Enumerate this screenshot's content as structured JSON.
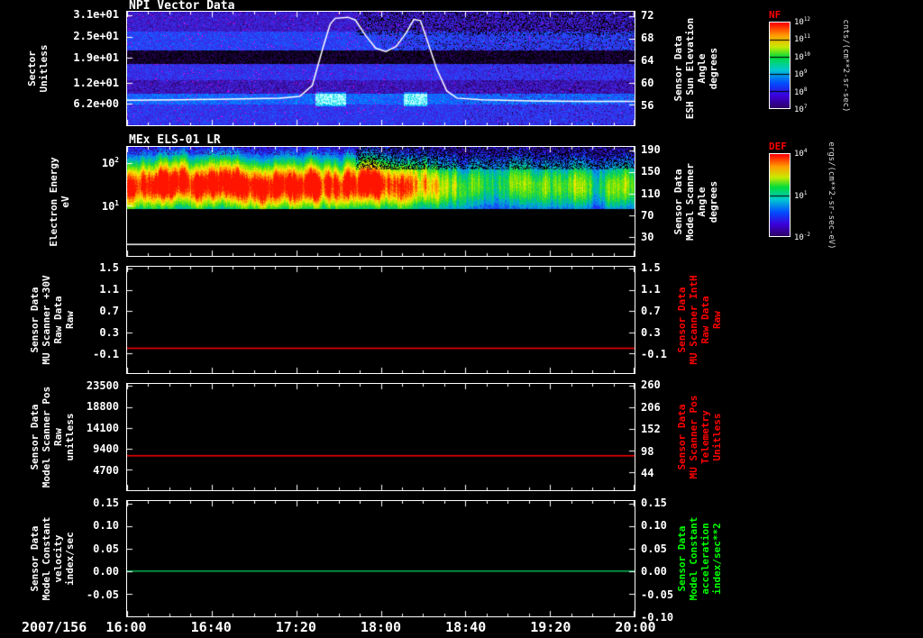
{
  "figure": {
    "bg": "#000000",
    "text_color": "#ffffff",
    "accent_red": "#ff0000",
    "accent_green": "#00ff00"
  },
  "chart_data": {
    "type": "heatmap",
    "description": "Five stacked time-series panels (NPI sector spectrogram with sun elevation line, ELS electron energy spectrogram, and three constant-value housekeeping traces) for day 2007/156, 16:00-20:00 UT",
    "time_axis": {
      "date": "2007/156",
      "start": "16:00",
      "end": "20:00",
      "ticks": [
        "16:00",
        "16:40",
        "17:20",
        "18:00",
        "18:40",
        "19:20",
        "20:00"
      ]
    },
    "panels": [
      {
        "title": "NPI Vector Data",
        "kind": "spectrogram+line",
        "left_label_lines": [
          "Sector",
          "Unitless"
        ],
        "left_range": [
          32,
          0
        ],
        "left_ticks": [
          {
            "label": "3.1e+01",
            "value": 31
          },
          {
            "label": "2.5e+01",
            "value": 25
          },
          {
            "label": "1.9e+01",
            "value": 19
          },
          {
            "label": "1.2e+01",
            "value": 12
          },
          {
            "label": "6.2e+00",
            "value": 6.2
          }
        ],
        "right_label_lines": [
          "Sensor Data",
          "ESH Sun Elevation",
          "Angle",
          "degrees"
        ],
        "right_label_color": "#ffffff",
        "right_range": [
          72.8,
          52.3
        ],
        "right_ticks": [
          {
            "label": "72",
            "value": 72
          },
          {
            "label": "68",
            "value": 68
          },
          {
            "label": "64",
            "value": 64
          },
          {
            "label": "60",
            "value": 60
          },
          {
            "label": "56",
            "value": 56
          }
        ],
        "line": {
          "name": "ESH Sun Elevation Angle",
          "color": "#ffffff",
          "axis": "right",
          "points": [
            [
              0,
              56.8
            ],
            [
              0.1,
              56.9
            ],
            [
              0.2,
              57
            ],
            [
              0.3,
              57.2
            ],
            [
              0.34,
              57.5
            ],
            [
              0.365,
              59.5
            ],
            [
              0.385,
              66
            ],
            [
              0.4,
              70.5
            ],
            [
              0.41,
              71.6
            ],
            [
              0.435,
              71.8
            ],
            [
              0.45,
              71.3
            ],
            [
              0.47,
              68.5
            ],
            [
              0.49,
              66.2
            ],
            [
              0.51,
              65.6
            ],
            [
              0.53,
              66.5
            ],
            [
              0.55,
              69
            ],
            [
              0.565,
              71.4
            ],
            [
              0.578,
              71.2
            ],
            [
              0.59,
              68
            ],
            [
              0.61,
              62.5
            ],
            [
              0.63,
              58.5
            ],
            [
              0.65,
              57.2
            ],
            [
              0.7,
              56.9
            ],
            [
              0.8,
              56.7
            ],
            [
              0.9,
              56.6
            ],
            [
              1,
              56.6
            ]
          ]
        },
        "spectrogram": {
          "summary": "blue/violet sector count map; near-black band around sectors 14-18, bright blue row near sectors 7-9 with cyan patches near 17:30 and 18:10, magenta speckles before 18:40, black dropouts upper right"
        }
      },
      {
        "title": "MEx ELS-01 LR",
        "kind": "spectrogram+line",
        "left_label_lines": [
          "Electron Energy",
          "eV"
        ],
        "left_scale": "log10_eV",
        "left_range": [
          2.375,
          -0.19
        ],
        "left_ticks": [
          {
            "label": "10^2",
            "value": 2
          },
          {
            "label": "10^1",
            "value": 1
          }
        ],
        "right_label_lines": [
          "Sensor Data",
          "Model Scanner",
          "Angle",
          "degrees"
        ],
        "right_label_color": "#ffffff",
        "right_range": [
          196.6,
          -5.9
        ],
        "right_ticks": [
          {
            "label": "190",
            "value": 190
          },
          {
            "label": "150",
            "value": 150
          },
          {
            "label": "110",
            "value": 110
          },
          {
            "label": "70",
            "value": 70
          },
          {
            "label": "30",
            "value": 30
          }
        ],
        "line": {
          "name": "Model Scanner Angle",
          "color": "#ffffff",
          "axis": "right",
          "points": [
            [
              0,
              15.5
            ],
            [
              1,
              15.5
            ]
          ]
        },
        "spectrogram": {
          "summary": "electron differential energy flux ~8-240 eV; intense red/yellow band 20-80 eV until ~18:10, weakening to green/blue afterwards, black dropout speckles at high energy on right half",
          "energy_cut_log": 0.92
        }
      },
      {
        "title": "",
        "kind": "line",
        "left_label_lines": [
          "Sensor Data",
          "MU Scanner +30V",
          "Raw Data",
          "Raw"
        ],
        "left_range": [
          1.54,
          -0.47
        ],
        "left_ticks": [
          {
            "label": "1.5",
            "value": 1.5
          },
          {
            "label": "1.1",
            "value": 1.1
          },
          {
            "label": "0.7",
            "value": 0.7
          },
          {
            "label": "0.3",
            "value": 0.3
          },
          {
            "label": "-0.1",
            "value": -0.1
          }
        ],
        "right_label_lines": [
          "Sensor Data",
          "MU Scanner IntH",
          "Raw Data",
          "Raw"
        ],
        "right_label_color": "#ff0000",
        "right_range": [
          1.54,
          -0.47
        ],
        "right_ticks": [
          {
            "label": "1.5",
            "value": 1.5
          },
          {
            "label": "1.1",
            "value": 1.1
          },
          {
            "label": "0.7",
            "value": 0.7
          },
          {
            "label": "0.3",
            "value": 0.3
          },
          {
            "label": "-0.1",
            "value": -0.1
          }
        ],
        "line": {
          "name": "MU Scanner +30V Raw",
          "color": "#ff0000",
          "axis": "left",
          "points": [
            [
              0,
              0
            ],
            [
              1,
              0
            ]
          ]
        }
      },
      {
        "title": "",
        "kind": "line",
        "left_label_lines": [
          "Sensor Data",
          "Model Scanner Pos",
          "Raw",
          "unitless"
        ],
        "left_range": [
          24000,
          0
        ],
        "left_ticks": [
          {
            "label": "23500",
            "value": 23500
          },
          {
            "label": "18800",
            "value": 18800
          },
          {
            "label": "14100",
            "value": 14100
          },
          {
            "label": "9400",
            "value": 9400
          },
          {
            "label": "4700",
            "value": 4700
          }
        ],
        "right_label_lines": [
          "Sensor Data",
          "MU Scanner Pos",
          "Telemetry",
          "Unitless"
        ],
        "right_label_color": "#ff0000",
        "right_range": [
          265.5,
          0
        ],
        "right_ticks": [
          {
            "label": "260",
            "value": 260
          },
          {
            "label": "206",
            "value": 206
          },
          {
            "label": "152",
            "value": 152
          },
          {
            "label": "98",
            "value": 98
          },
          {
            "label": "44",
            "value": 44
          }
        ],
        "line": {
          "name": "Model Scanner Pos Raw",
          "color": "#ff0000",
          "axis": "left",
          "points": [
            [
              0,
              7800
            ],
            [
              1,
              7800
            ]
          ]
        }
      },
      {
        "title": "",
        "kind": "line",
        "left_label_lines": [
          "Sensor Data",
          "Model Constant",
          "velocity",
          "index/sec"
        ],
        "left_range": [
          0.155,
          -0.1
        ],
        "left_ticks": [
          {
            "label": "0.15",
            "value": 0.15
          },
          {
            "label": "0.10",
            "value": 0.1
          },
          {
            "label": "0.05",
            "value": 0.05
          },
          {
            "label": "0.00",
            "value": 0
          },
          {
            "label": "-0.05",
            "value": -0.05
          }
        ],
        "right_label_lines": [
          "Sensor Data",
          "Model Constant",
          "acceleration",
          "index/sec**2"
        ],
        "right_label_color": "#00ff00",
        "right_range": [
          0.155,
          -0.1
        ],
        "right_ticks": [
          {
            "label": "0.15",
            "value": 0.15
          },
          {
            "label": "0.10",
            "value": 0.1
          },
          {
            "label": "0.05",
            "value": 0.05
          },
          {
            "label": "0.00",
            "value": 0
          },
          {
            "label": "-0.05",
            "value": -0.05
          },
          {
            "label": "-0.10",
            "value": -0.1
          }
        ],
        "line": {
          "name": "Model Constant velocity",
          "color": "#00bb55",
          "axis": "left",
          "points": [
            [
              0,
              0
            ],
            [
              1,
              0
            ]
          ]
        }
      }
    ],
    "colorbars": [
      {
        "id": "nf",
        "title": "NF",
        "title_color": "#ff0000",
        "ticks": [
          "10^12",
          "10^11",
          "10^10",
          "10^9",
          "10^8",
          "10^7"
        ],
        "units": "cnts/(cm**2-sr-sec)"
      },
      {
        "id": "def",
        "title": "DEF",
        "title_color": "#ff0000",
        "ticks": [
          "10^4",
          "10^1",
          "10^-2"
        ],
        "units": "ergs/(cm**2-sr-sec-eV)"
      }
    ]
  }
}
